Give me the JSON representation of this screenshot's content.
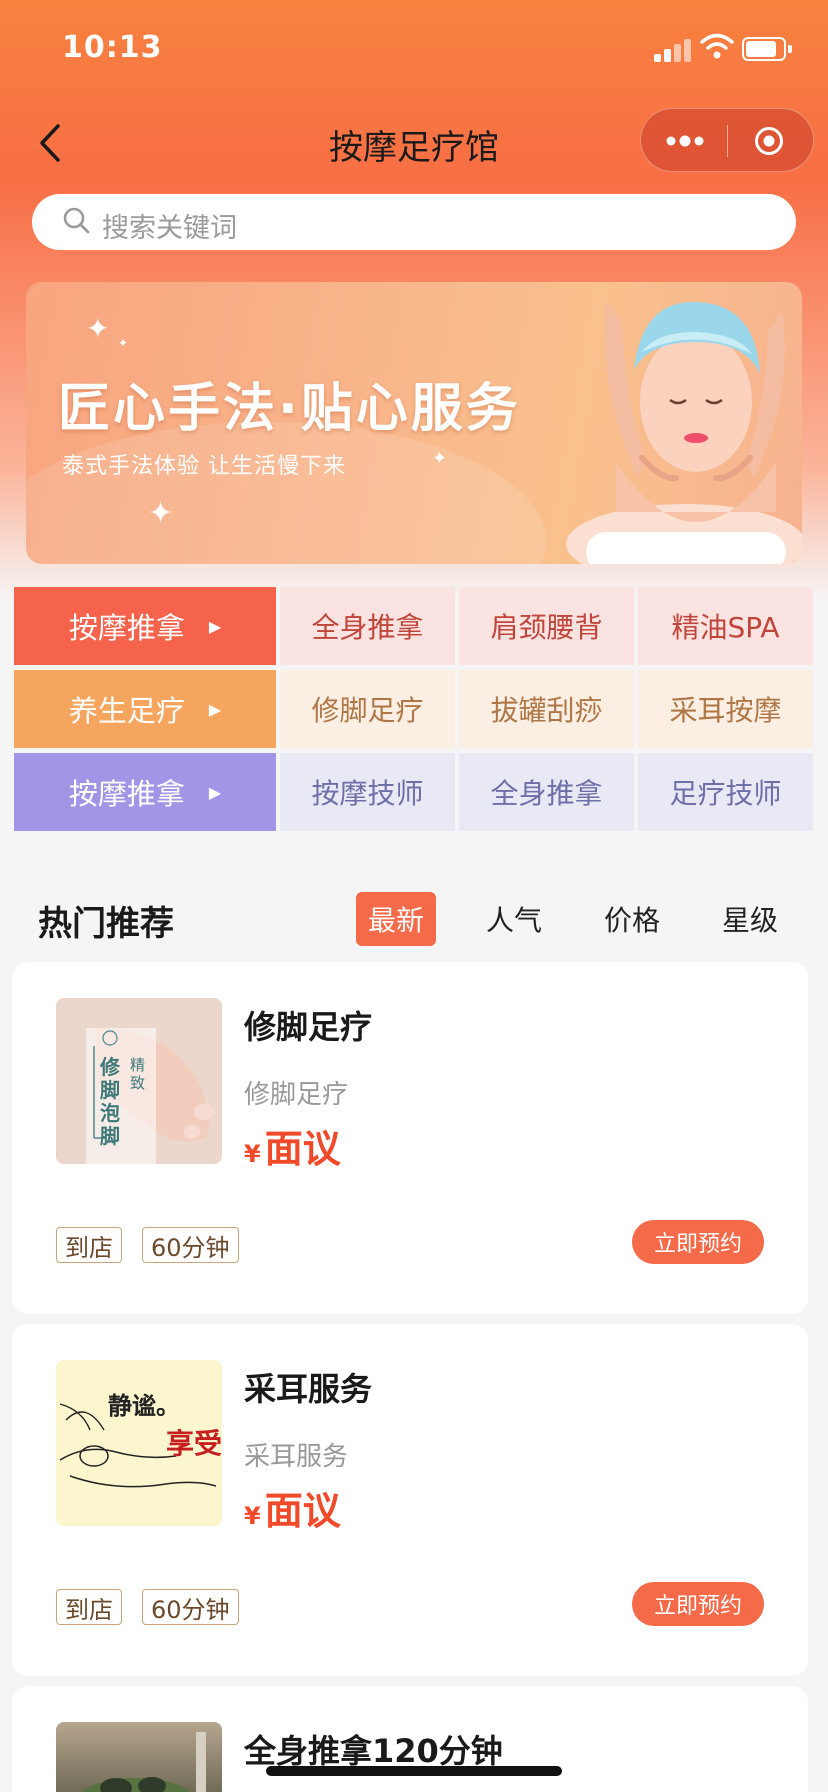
{
  "status_bar": {
    "time": "10:13"
  },
  "nav": {
    "title": "按摩足疗馆"
  },
  "search": {
    "placeholder": "搜索关键词"
  },
  "banner": {
    "headline": "匠心手法·贴心服务",
    "subline": "泰式手法体验 让生活慢下来"
  },
  "categories": [
    {
      "head": "按摩推拿",
      "head_color": "#f5634c",
      "cell_bg": "#fbe3e1",
      "text_color": "#c0453a",
      "items": [
        "全身推拿",
        "肩颈腰背",
        "精油SPA"
      ]
    },
    {
      "head": "养生足疗",
      "head_color": "#f6a55e",
      "cell_bg": "#fbeee2",
      "text_color": "#b07746",
      "items": [
        "修脚足疗",
        "拔罐刮痧",
        "采耳按摩"
      ]
    },
    {
      "head": "按摩推拿",
      "head_color": "#a395e6",
      "cell_bg": "#e8e9f5",
      "text_color": "#6e6fa8",
      "items": [
        "按摩技师",
        "全身推拿",
        "足疗技师"
      ]
    }
  ],
  "recommend": {
    "title": "热门推荐",
    "sort_tabs": [
      "最新",
      "人气",
      "价格",
      "星级"
    ],
    "active_sort": "最新"
  },
  "services": [
    {
      "title": "修脚足疗",
      "subtitle": "修脚足疗",
      "currency": "¥",
      "price": "面议",
      "tags": [
        "到店",
        "60分钟"
      ],
      "book_label": "立即预约",
      "thumb_text": "修脚泡脚",
      "thumb_small": "精致"
    },
    {
      "title": "采耳服务",
      "subtitle": "采耳服务",
      "currency": "¥",
      "price": "面议",
      "tags": [
        "到店",
        "60分钟"
      ],
      "book_label": "立即预约",
      "thumb_text": "静谧。",
      "thumb_small": "享受"
    },
    {
      "title": "全身推拿120分钟"
    }
  ],
  "colors": {
    "accent": "#f56a48",
    "price": "#f04a2a"
  }
}
